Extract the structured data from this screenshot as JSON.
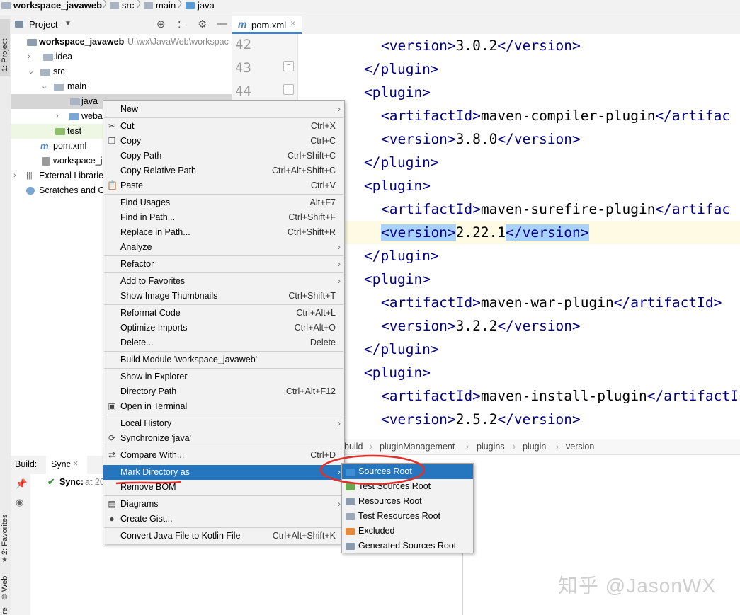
{
  "breadcrumb": [
    "workspace_javaweb",
    "src",
    "main",
    "java"
  ],
  "side_tabs": {
    "project": "1: Project",
    "favorites": "2: Favorites",
    "web": "Web",
    "structure": "re"
  },
  "project_panel": {
    "title": "Project",
    "tree": [
      {
        "label": "workspace_javaweb",
        "path_hint": "U:\\wx\\JavaWeb\\workspac",
        "expanded": true
      },
      {
        "label": ".idea"
      },
      {
        "label": "src",
        "expanded": true
      },
      {
        "label": "main",
        "expanded": true
      },
      {
        "label": "java",
        "selected": true
      },
      {
        "label": "weba"
      },
      {
        "label": "test"
      },
      {
        "label": "pom.xml"
      },
      {
        "label": "workspace_j"
      },
      {
        "label": "External Librarie"
      },
      {
        "label": "Scratches and C"
      }
    ]
  },
  "editor": {
    "tab": "pom.xml",
    "line_numbers": [
      "42",
      "43",
      "44"
    ],
    "code": [
      {
        "open": "<version>",
        "text": "3.0.2",
        "close": "</version>",
        "indent": 1
      },
      {
        "open": "",
        "text": "",
        "close": "</plugin>",
        "indent": 0
      },
      {
        "open": "<plugin>",
        "text": "",
        "close": "",
        "indent": 0
      },
      {
        "open": "<artifactId>",
        "text": "maven-compiler-plugin",
        "close": "</artifac",
        "indent": 1
      },
      {
        "open": "<version>",
        "text": "3.8.0",
        "close": "</version>",
        "indent": 1
      },
      {
        "open": "",
        "text": "",
        "close": "</plugin>",
        "indent": 0
      },
      {
        "open": "<plugin>",
        "text": "",
        "close": "",
        "indent": 0
      },
      {
        "open": "<artifactId>",
        "text": "maven-surefire-plugin",
        "close": "</artifac",
        "indent": 1
      },
      {
        "open": "<version>",
        "text": "2.22.1",
        "close": "</version>",
        "indent": 1,
        "highlight": true
      },
      {
        "open": "",
        "text": "",
        "close": "</plugin>",
        "indent": 0
      },
      {
        "open": "<plugin>",
        "text": "",
        "close": "",
        "indent": 0
      },
      {
        "open": "<artifactId>",
        "text": "maven-war-plugin",
        "close": "</artifactId>",
        "indent": 1
      },
      {
        "open": "<version>",
        "text": "3.2.2",
        "close": "</version>",
        "indent": 1
      },
      {
        "open": "",
        "text": "",
        "close": "</plugin>",
        "indent": 0
      },
      {
        "open": "<plugin>",
        "text": "",
        "close": "",
        "indent": 0
      },
      {
        "open": "<artifactId>",
        "text": "maven-install-plugin",
        "close": "</artifactI",
        "indent": 1
      },
      {
        "open": "<version>",
        "text": "2.5.2",
        "close": "</version>",
        "indent": 1
      }
    ],
    "crumbs": [
      "build",
      "pluginManagement",
      "plugins",
      "plugin",
      "version"
    ]
  },
  "build_panel": {
    "label": "Build:",
    "tab": "Sync",
    "status": "Sync:",
    "status_time": "at 20"
  },
  "context_menu": [
    {
      "label": "New",
      "shortcut": "",
      "submenu": true
    },
    {
      "sep": true
    },
    {
      "label": "Cut",
      "shortcut": "Ctrl+X",
      "icon": "✂"
    },
    {
      "label": "Copy",
      "shortcut": "Ctrl+C",
      "icon": "❐"
    },
    {
      "label": "Copy Path",
      "shortcut": "Ctrl+Shift+C"
    },
    {
      "label": "Copy Relative Path",
      "shortcut": "Ctrl+Alt+Shift+C"
    },
    {
      "label": "Paste",
      "shortcut": "Ctrl+V",
      "icon": "📋"
    },
    {
      "sep": true
    },
    {
      "label": "Find Usages",
      "shortcut": "Alt+F7"
    },
    {
      "label": "Find in Path...",
      "shortcut": "Ctrl+Shift+F"
    },
    {
      "label": "Replace in Path...",
      "shortcut": "Ctrl+Shift+R"
    },
    {
      "label": "Analyze",
      "shortcut": "",
      "submenu": true
    },
    {
      "sep": true
    },
    {
      "label": "Refactor",
      "shortcut": "",
      "submenu": true
    },
    {
      "sep": true
    },
    {
      "label": "Add to Favorites",
      "shortcut": "",
      "submenu": true
    },
    {
      "label": "Show Image Thumbnails",
      "shortcut": "Ctrl+Shift+T"
    },
    {
      "sep": true
    },
    {
      "label": "Reformat Code",
      "shortcut": "Ctrl+Alt+L"
    },
    {
      "label": "Optimize Imports",
      "shortcut": "Ctrl+Alt+O"
    },
    {
      "label": "Delete...",
      "shortcut": "Delete"
    },
    {
      "sep": true
    },
    {
      "label": "Build Module 'workspace_javaweb'",
      "shortcut": ""
    },
    {
      "sep": true
    },
    {
      "label": "Show in Explorer",
      "shortcut": ""
    },
    {
      "label": "Directory Path",
      "shortcut": "Ctrl+Alt+F12"
    },
    {
      "label": "Open in Terminal",
      "shortcut": "",
      "icon": "▣"
    },
    {
      "sep": true
    },
    {
      "label": "Local History",
      "shortcut": "",
      "submenu": true
    },
    {
      "label": "Synchronize 'java'",
      "shortcut": "",
      "icon": "⟳"
    },
    {
      "sep": true
    },
    {
      "label": "Compare With...",
      "shortcut": "Ctrl+D",
      "icon": "⇄"
    },
    {
      "sep": true
    },
    {
      "label": "Mark Directory as",
      "shortcut": "",
      "submenu": true,
      "active": true
    },
    {
      "label": "Remove BOM",
      "shortcut": ""
    },
    {
      "sep": true
    },
    {
      "label": "Diagrams",
      "shortcut": "",
      "submenu": true,
      "icon": "▤"
    },
    {
      "label": "Create Gist...",
      "shortcut": "",
      "icon": "●"
    },
    {
      "sep": true
    },
    {
      "label": "Convert Java File to Kotlin File",
      "shortcut": "Ctrl+Alt+Shift+K"
    }
  ],
  "submenu": [
    {
      "label": "Sources Root",
      "color": "#3f8fd6",
      "active": true
    },
    {
      "label": "Test Sources Root",
      "color": "#6aa84f"
    },
    {
      "label": "Resources Root",
      "color": "#8a9bb0"
    },
    {
      "label": "Test Resources Root",
      "color": "#9aa8b8"
    },
    {
      "label": "Excluded",
      "color": "#e8893a"
    },
    {
      "label": "Generated Sources Root",
      "color": "#8a9bb0"
    }
  ],
  "watermark": "知乎 @JasonWX",
  "colors": {
    "accent": "#2675bf",
    "tag": "#000080",
    "selection": "#a9d2ff",
    "annotation": "#e0302a"
  }
}
